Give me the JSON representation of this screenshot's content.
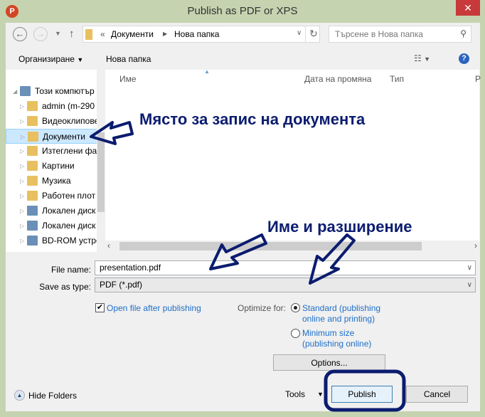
{
  "window": {
    "title": "Publish as PDF or XPS",
    "app_icon": "P",
    "close": "✕"
  },
  "address": {
    "prefix": "«",
    "crumbs": [
      "Документи",
      "Нова папка"
    ],
    "search_placeholder": "Търсене в Нова папка"
  },
  "toolbar": {
    "organize": "Организиране",
    "new_folder": "Нова папка"
  },
  "columns": [
    "Име",
    "Дата на промяна",
    "Тип",
    "Р"
  ],
  "tree": [
    {
      "label": "Този компютър",
      "icon": "computer-icon"
    },
    {
      "label": "admin (m-290",
      "icon": "user-icon"
    },
    {
      "label": "Видеоклипове",
      "icon": "video-folder-icon"
    },
    {
      "label": "Документи",
      "icon": "documents-folder-icon",
      "selected": true
    },
    {
      "label": "Изтеглени файлове",
      "icon": "downloads-folder-icon"
    },
    {
      "label": "Картини",
      "icon": "pictures-folder-icon"
    },
    {
      "label": "Музика",
      "icon": "music-folder-icon"
    },
    {
      "label": "Работен плот",
      "icon": "desktop-folder-icon"
    },
    {
      "label": "Локален диск",
      "icon": "drive-icon"
    },
    {
      "label": "Локален диск",
      "icon": "drive-icon"
    },
    {
      "label": "BD-ROM устройство",
      "icon": "disc-drive-icon"
    }
  ],
  "form": {
    "file_name_label": "File name:",
    "file_name": "presentation.pdf",
    "type_label": "Save as type:",
    "type": "PDF (*.pdf)",
    "open_after": "Open file after publishing",
    "open_after_checked": true,
    "optimize_label": "Optimize for:",
    "opt_standard_1": "Standard (publishing",
    "opt_standard_2": "online and printing)",
    "opt_min_1": "Minimum size",
    "opt_min_2": "(publishing online)",
    "selected_option": "standard",
    "options_btn": "Options..."
  },
  "footer": {
    "hide_folders": "Hide Folders",
    "tools": "Tools",
    "publish": "Publish",
    "cancel": "Cancel"
  },
  "annotations": {
    "location": "Място за запис на документа",
    "name_ext": "Име и разширение"
  },
  "colors": {
    "annotation": "#0b1c6f",
    "frame": "#c6d3b0",
    "close": "#c7393a",
    "link": "#1e6fc8"
  }
}
